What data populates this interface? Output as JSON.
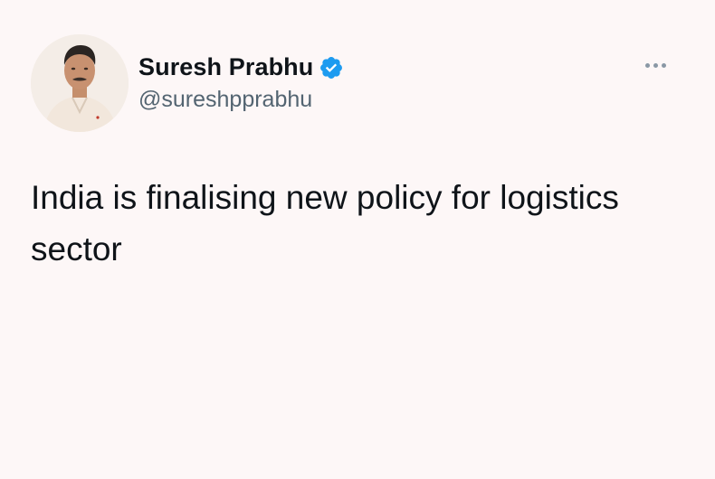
{
  "author": {
    "display_name": "Suresh Prabhu",
    "handle": "@sureshpprabhu",
    "verified": true,
    "avatar_icon": "user-avatar-photo",
    "verified_icon": "verified-badge-icon",
    "verified_color": "#1d9bf0"
  },
  "tweet": {
    "text": "India is finalising new policy for logistics sector"
  },
  "actions": {
    "more_icon": "more-options-icon"
  },
  "colors": {
    "background": "#fdf7f7",
    "text_primary": "#0f1419",
    "text_secondary": "#536471"
  }
}
